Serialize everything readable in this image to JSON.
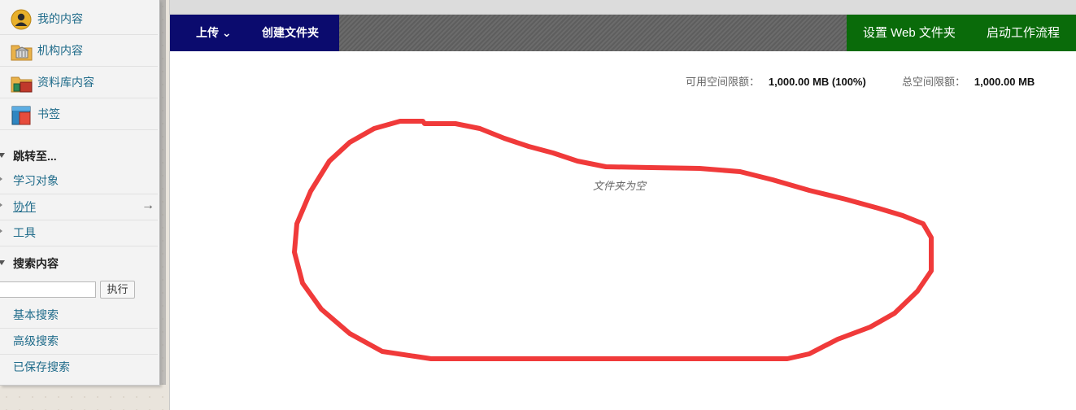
{
  "sidebar": {
    "nav": [
      {
        "label": "我的内容",
        "icon": "user-avatar-icon"
      },
      {
        "label": "机构内容",
        "icon": "institution-folder-icon"
      },
      {
        "label": "资料库内容",
        "icon": "library-folder-icon"
      },
      {
        "label": "书签",
        "icon": "bookmark-icon"
      }
    ],
    "jump_heading": "跳转至...",
    "jump_items": [
      "学习对象",
      "协作",
      "工具"
    ],
    "collab_arrow": "→",
    "search_heading": "搜索内容",
    "search_input_value": "",
    "search_go": "执行",
    "search_links": [
      "基本搜索",
      "高级搜索",
      "已保存搜索"
    ]
  },
  "toolbar": {
    "upload": "上传 ⌄",
    "create_folder": "创建文件夹",
    "setup_webfolder": "设置 Web 文件夹",
    "start_workflow": "启动工作流程",
    "colors": {
      "left": "#0b0b6e",
      "right": "#0a6b0a"
    }
  },
  "quota": {
    "available_label": "可用空间限额：",
    "available_value": "1,000.00 MB (100%)",
    "total_label": "总空间限额：",
    "total_value": "1,000.00 MB"
  },
  "content": {
    "empty_message": "文件夹为空"
  },
  "annotation_color": "#f03a3a"
}
